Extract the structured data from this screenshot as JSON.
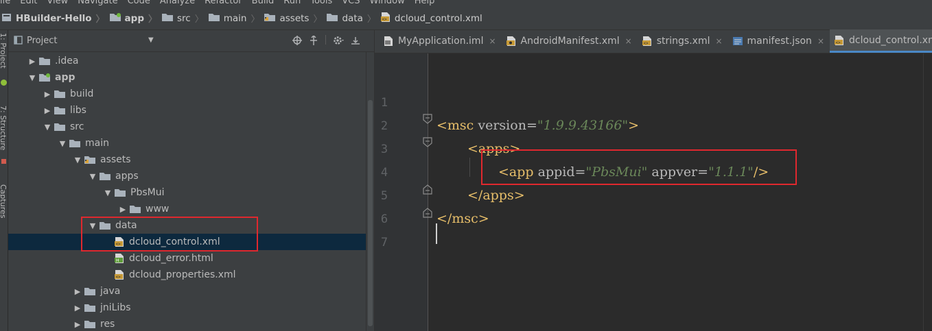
{
  "menu": [
    "ile",
    "Edit",
    "View",
    "Navigate",
    "Code",
    "Analyze",
    "Refactor",
    "Build",
    "Run",
    "Tools",
    "VCS",
    "Window",
    "Help"
  ],
  "breadcrumb": [
    {
      "label": "HBuilder-Hello",
      "icon": "project-icon",
      "bold": true
    },
    {
      "label": "app",
      "icon": "module-folder-icon",
      "bold": true
    },
    {
      "label": "src",
      "icon": "folder-icon",
      "bold": false
    },
    {
      "label": "main",
      "icon": "folder-icon",
      "bold": false
    },
    {
      "label": "assets",
      "icon": "resource-folder-icon",
      "bold": false
    },
    {
      "label": "data",
      "icon": "folder-icon",
      "bold": false
    },
    {
      "label": "dcloud_control.xml",
      "icon": "xml-file-icon",
      "bold": false
    }
  ],
  "toolstrip": {
    "project_label": "1: Project",
    "structure_label": "7: Structure",
    "captures_label": "Captures"
  },
  "project_panel": {
    "title": "Project",
    "tree": [
      {
        "label": ".idea",
        "arrow": "▶",
        "type": "folder"
      },
      {
        "label": "app",
        "arrow": "▼",
        "type": "module",
        "bold": true
      },
      {
        "label": "build",
        "arrow": "▶",
        "type": "folder"
      },
      {
        "label": "libs",
        "arrow": "▶",
        "type": "folder"
      },
      {
        "label": "src",
        "arrow": "▼",
        "type": "folder"
      },
      {
        "label": "main",
        "arrow": "▼",
        "type": "folder"
      },
      {
        "label": "assets",
        "arrow": "▼",
        "type": "resource"
      },
      {
        "label": "apps",
        "arrow": "▼",
        "type": "folder"
      },
      {
        "label": "PbsMui",
        "arrow": "▼",
        "type": "folder"
      },
      {
        "label": "www",
        "arrow": "▶",
        "type": "folder"
      },
      {
        "label": "data",
        "arrow": "▼",
        "type": "folder"
      },
      {
        "label": "dcloud_control.xml",
        "arrow": "",
        "type": "xml",
        "selected": true
      },
      {
        "label": "dcloud_error.html",
        "arrow": "",
        "type": "html"
      },
      {
        "label": "dcloud_properties.xml",
        "arrow": "",
        "type": "xml"
      },
      {
        "label": "java",
        "arrow": "▶",
        "type": "folder"
      },
      {
        "label": "jniLibs",
        "arrow": "▶",
        "type": "folder"
      },
      {
        "label": "res",
        "arrow": "▶",
        "type": "folder"
      }
    ]
  },
  "tabs": [
    {
      "label": "MyApplication.iml",
      "icon": "iml-file-icon",
      "active": false
    },
    {
      "label": "AndroidManifest.xml",
      "icon": "manifest-file-icon",
      "active": false
    },
    {
      "label": "strings.xml",
      "icon": "xml-file-icon",
      "active": false
    },
    {
      "label": "manifest.json",
      "icon": "json-file-icon",
      "active": false
    },
    {
      "label": "dcloud_control.xml",
      "icon": "xml-file-icon",
      "active": true
    }
  ],
  "editor": {
    "line_numbers": [
      "1",
      "2",
      "3",
      "4",
      "5",
      "6",
      "7"
    ],
    "code": {
      "l2_tag_open": "<msc ",
      "l2_attr": "version=",
      "l2_val": "\"1.9.9.43166\"",
      "l2_close": ">",
      "l3": "<apps>",
      "l4_tag_open": "<app ",
      "l4_attr1": "appid=",
      "l4_val1": "\"PbsMui\"",
      "l4_attr2": " appver=",
      "l4_val2": "\"1.1.1\"",
      "l4_close": "/>",
      "l5": "</apps>",
      "l6": "</msc>"
    }
  },
  "colors": {
    "highlight_box": "#e0282e",
    "selection": "#0d293e",
    "tag": "#e8bf6a",
    "string": "#6a8759",
    "active_tab_accent": "#4a88c7"
  }
}
